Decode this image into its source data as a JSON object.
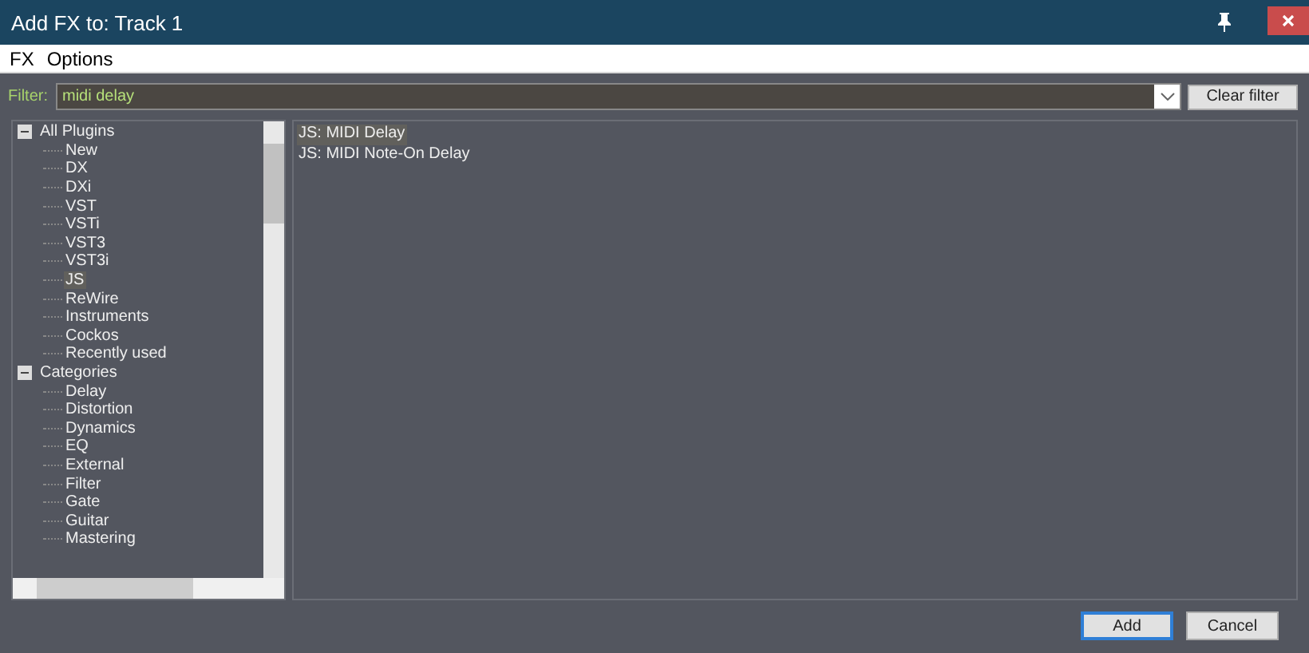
{
  "window": {
    "title": "Add FX to: Track 1"
  },
  "menu": [
    "FX",
    "Options"
  ],
  "filter": {
    "label": "Filter:",
    "value": "midi delay"
  },
  "clear_button": "Clear filter",
  "tree": [
    {
      "label": "All Plugins",
      "expanded": true,
      "selected": false,
      "children": [
        {
          "label": "New",
          "selected": false
        },
        {
          "label": "DX",
          "selected": false
        },
        {
          "label": "DXi",
          "selected": false
        },
        {
          "label": "VST",
          "selected": false
        },
        {
          "label": "VSTi",
          "selected": false
        },
        {
          "label": "VST3",
          "selected": false
        },
        {
          "label": "VST3i",
          "selected": false
        },
        {
          "label": "JS",
          "selected": true
        },
        {
          "label": "ReWire",
          "selected": false
        },
        {
          "label": "Instruments",
          "selected": false
        },
        {
          "label": "Cockos",
          "selected": false
        },
        {
          "label": "Recently used",
          "selected": false
        }
      ]
    },
    {
      "label": "Categories",
      "expanded": true,
      "selected": false,
      "children": [
        {
          "label": "Delay",
          "selected": false
        },
        {
          "label": "Distortion",
          "selected": false
        },
        {
          "label": "Dynamics",
          "selected": false
        },
        {
          "label": "EQ",
          "selected": false
        },
        {
          "label": "External",
          "selected": false
        },
        {
          "label": "Filter",
          "selected": false
        },
        {
          "label": "Gate",
          "selected": false
        },
        {
          "label": "Guitar",
          "selected": false
        },
        {
          "label": "Mastering",
          "selected": false
        }
      ]
    }
  ],
  "results": [
    {
      "label": "JS: MIDI Delay",
      "selected": true
    },
    {
      "label": "JS: MIDI Note-On Delay",
      "selected": false
    }
  ],
  "buttons": [
    {
      "label": "Add",
      "default": true
    },
    {
      "label": "Cancel",
      "default": false
    }
  ]
}
